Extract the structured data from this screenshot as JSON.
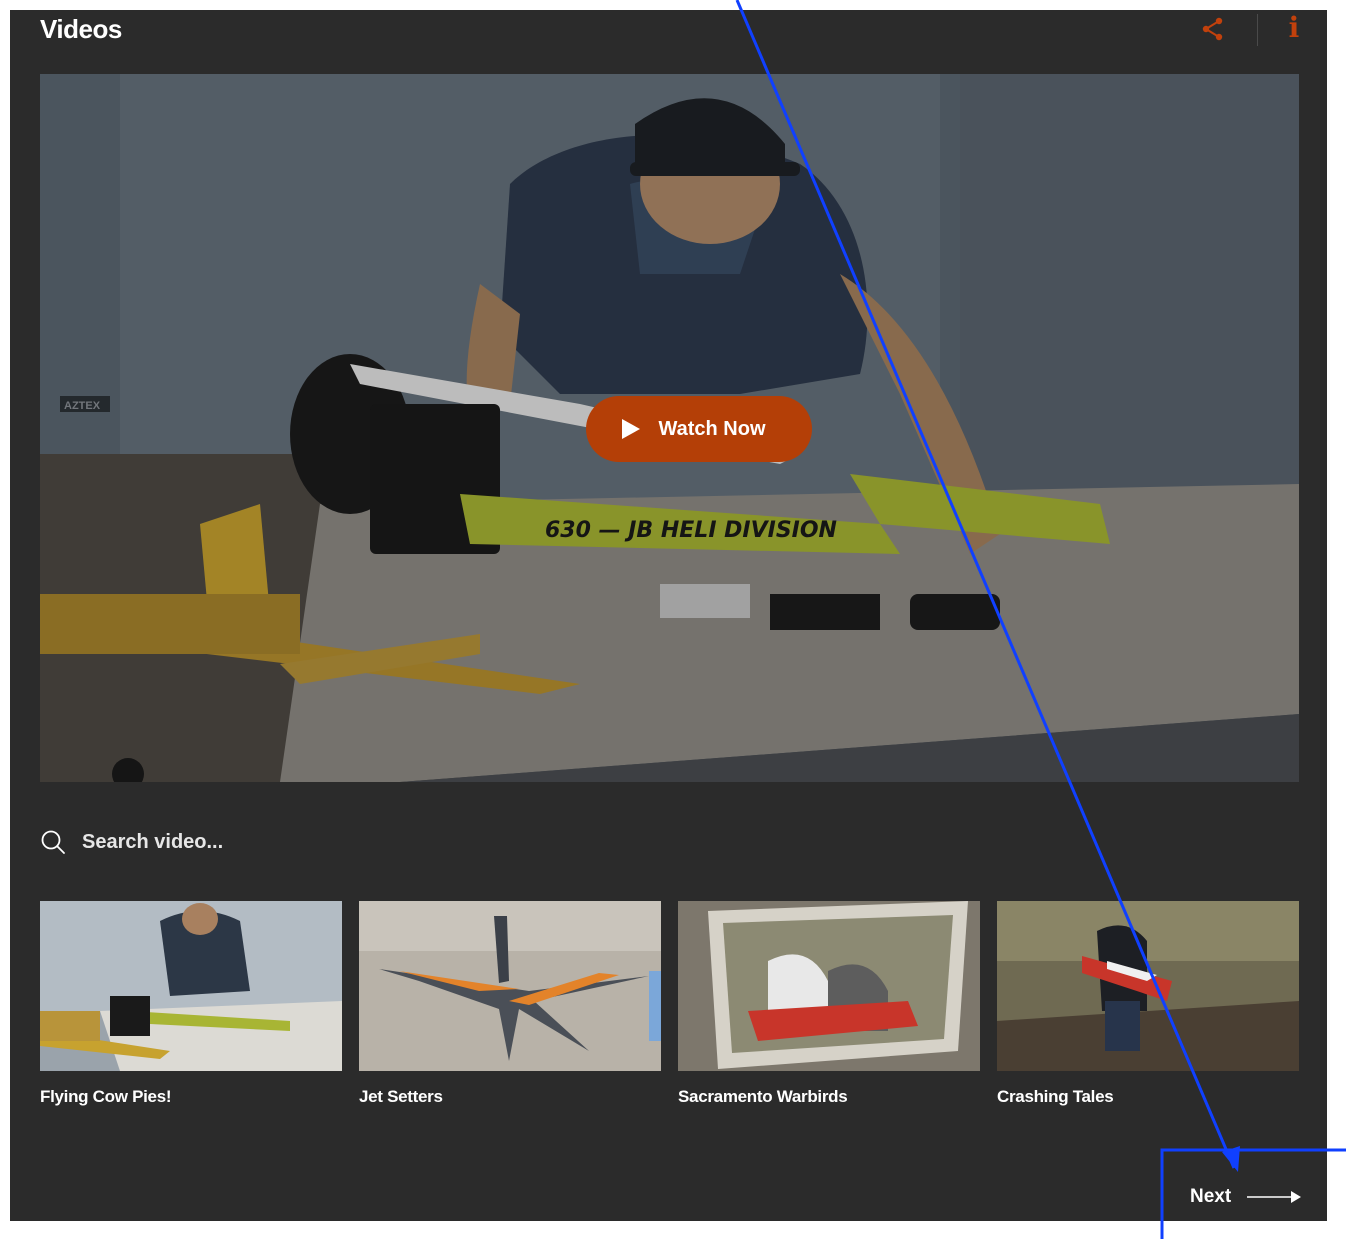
{
  "header": {
    "title": "Videos",
    "icons": {
      "share": "share-icon",
      "info": "info-icon"
    },
    "info_glyph": "i"
  },
  "hero": {
    "button_label": "Watch Now",
    "image_text": {
      "heli_label": "630 — JB HELI DIVISION",
      "truck_badge": "AZTEX"
    }
  },
  "search": {
    "placeholder": "Search video..."
  },
  "videos": [
    {
      "title": "Flying Cow Pies!"
    },
    {
      "title": "Jet Setters"
    },
    {
      "title": "Sacramento Warbirds"
    },
    {
      "title": "Crashing Tales"
    }
  ],
  "pager": {
    "next_label": "Next"
  },
  "colors": {
    "panel": "#2b2b2b",
    "accent": "#b43f07",
    "icon_accent": "#c2410c",
    "overlay_line": "#1040ff"
  }
}
